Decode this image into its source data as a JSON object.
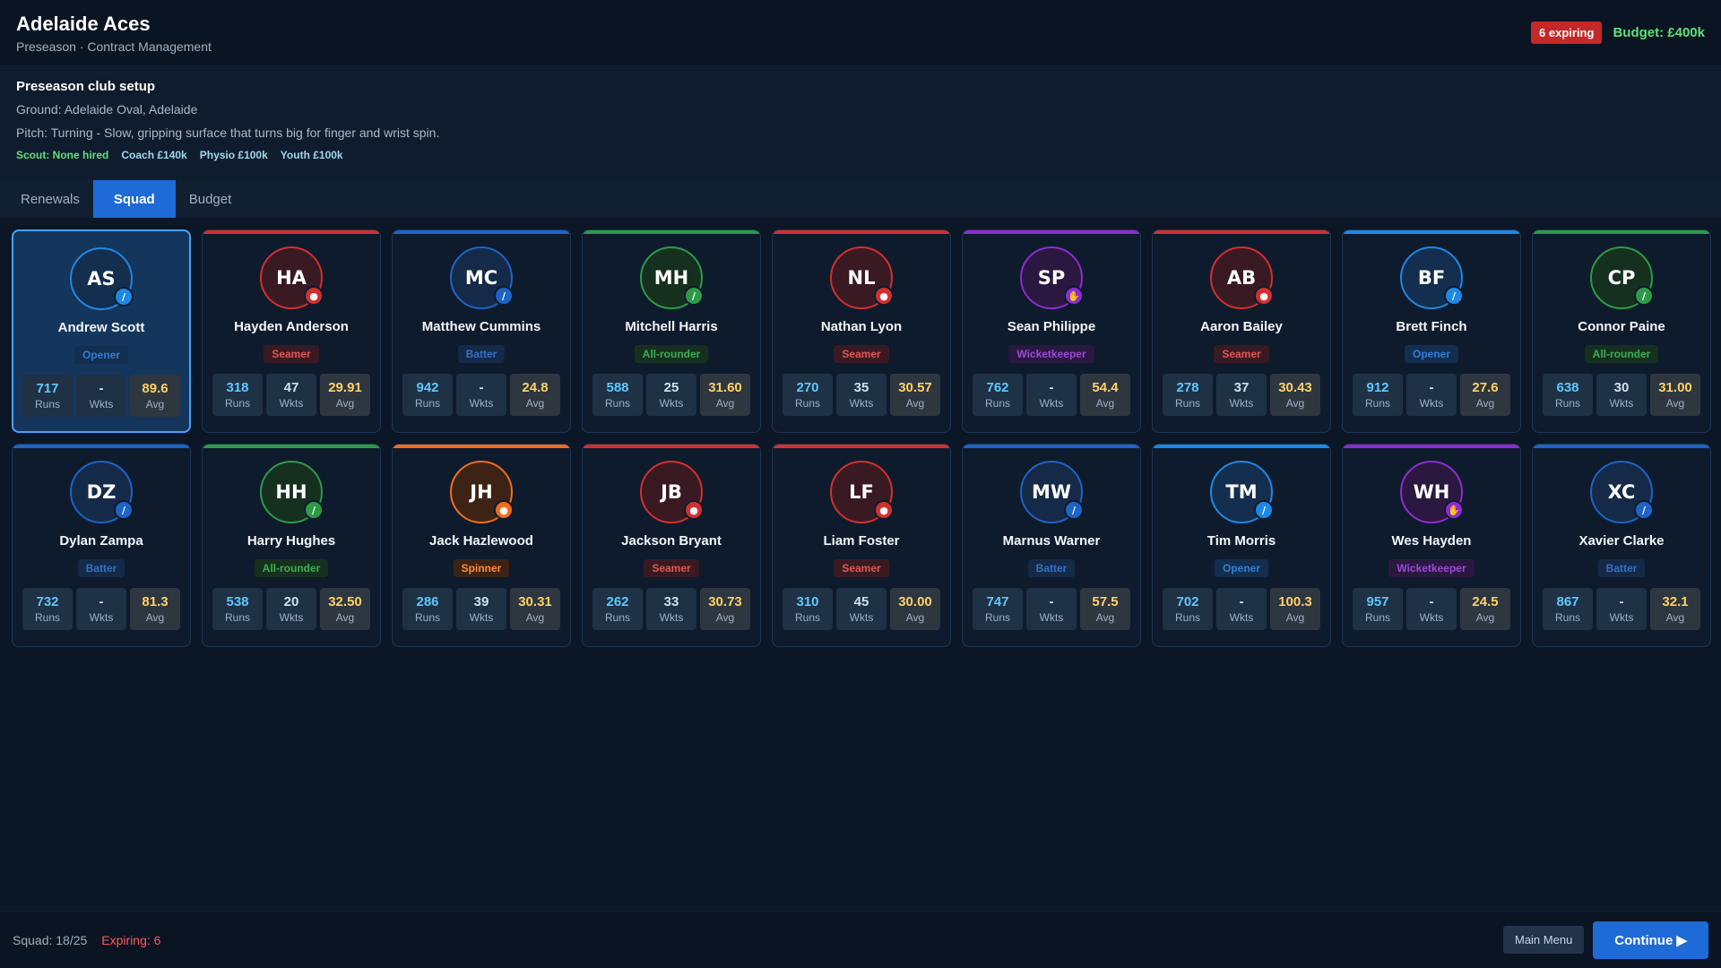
{
  "header": {
    "club_name": "Adelaide Aces",
    "subtitle": "Preseason · Contract Management",
    "expiring_badge": "6 expiring",
    "budget": "Budget: £400k"
  },
  "setup": {
    "title": "Preseason club setup",
    "ground": "Ground: Adelaide Oval, Adelaide",
    "pitch": "Pitch: Turning - Slow, gripping surface that turns big for finger and wrist spin.",
    "scout": "Scout: None hired",
    "coach": "Coach £140k",
    "physio": "Physio £100k",
    "youth": "Youth £100k"
  },
  "tabs": [
    {
      "label": "Renewals",
      "active": false
    },
    {
      "label": "Squad",
      "active": true
    },
    {
      "label": "Budget",
      "active": false
    }
  ],
  "stat_labels": {
    "runs": "Runs",
    "wkts": "Wkts",
    "avg": "Avg"
  },
  "role_styles": {
    "Opener": {
      "color": "#1e88e5",
      "tag_bg": "#132e4e",
      "tag_fg": "#2f7fd8",
      "icon": "bat-ball-icon"
    },
    "Batter": {
      "color": "#1e63c6",
      "tag_bg": "#142a48",
      "tag_fg": "#3570c4",
      "icon": "bat-icon"
    },
    "Seamer": {
      "color": "#d32f2f",
      "tag_bg": "#3a1a22",
      "tag_fg": "#e05555",
      "icon": "ball-icon"
    },
    "Spinner": {
      "color": "#f26b1d",
      "tag_bg": "#3d2316",
      "tag_fg": "#ff8a3d",
      "icon": "ball-icon"
    },
    "All-rounder": {
      "color": "#2e9a48",
      "tag_bg": "#16301f",
      "tag_fg": "#3cae55",
      "icon": "bat-ball-icon"
    },
    "Wicketkeeper": {
      "color": "#8e2bd0",
      "tag_bg": "#2a1840",
      "tag_fg": "#9b4ad6",
      "icon": "gloves-icon"
    }
  },
  "players": [
    {
      "initials": "AS",
      "name": "Andrew Scott",
      "role": "Opener",
      "runs": "717",
      "wkts": "-",
      "avg": "89.6",
      "selected": true
    },
    {
      "initials": "HA",
      "name": "Hayden Anderson",
      "role": "Seamer",
      "runs": "318",
      "wkts": "47",
      "avg": "29.91"
    },
    {
      "initials": "MC",
      "name": "Matthew Cummins",
      "role": "Batter",
      "runs": "942",
      "wkts": "-",
      "avg": "24.8"
    },
    {
      "initials": "MH",
      "name": "Mitchell Harris",
      "role": "All-rounder",
      "runs": "588",
      "wkts": "25",
      "avg": "31.60"
    },
    {
      "initials": "NL",
      "name": "Nathan Lyon",
      "role": "Seamer",
      "runs": "270",
      "wkts": "35",
      "avg": "30.57"
    },
    {
      "initials": "SP",
      "name": "Sean Philippe",
      "role": "Wicketkeeper",
      "runs": "762",
      "wkts": "-",
      "avg": "54.4"
    },
    {
      "initials": "AB",
      "name": "Aaron Bailey",
      "role": "Seamer",
      "runs": "278",
      "wkts": "37",
      "avg": "30.43"
    },
    {
      "initials": "BF",
      "name": "Brett Finch",
      "role": "Opener",
      "runs": "912",
      "wkts": "-",
      "avg": "27.6"
    },
    {
      "initials": "CP",
      "name": "Connor Paine",
      "role": "All-rounder",
      "runs": "638",
      "wkts": "30",
      "avg": "31.00"
    },
    {
      "initials": "DZ",
      "name": "Dylan Zampa",
      "role": "Batter",
      "runs": "732",
      "wkts": "-",
      "avg": "81.3"
    },
    {
      "initials": "HH",
      "name": "Harry Hughes",
      "role": "All-rounder",
      "runs": "538",
      "wkts": "20",
      "avg": "32.50"
    },
    {
      "initials": "JH",
      "name": "Jack Hazlewood",
      "role": "Spinner",
      "runs": "286",
      "wkts": "39",
      "avg": "30.31"
    },
    {
      "initials": "JB",
      "name": "Jackson Bryant",
      "role": "Seamer",
      "runs": "262",
      "wkts": "33",
      "avg": "30.73"
    },
    {
      "initials": "LF",
      "name": "Liam Foster",
      "role": "Seamer",
      "runs": "310",
      "wkts": "45",
      "avg": "30.00"
    },
    {
      "initials": "MW",
      "name": "Marnus Warner",
      "role": "Batter",
      "runs": "747",
      "wkts": "-",
      "avg": "57.5"
    },
    {
      "initials": "TM",
      "name": "Tim Morris",
      "role": "Opener",
      "runs": "702",
      "wkts": "-",
      "avg": "100.3"
    },
    {
      "initials": "WH",
      "name": "Wes Hayden",
      "role": "Wicketkeeper",
      "runs": "957",
      "wkts": "-",
      "avg": "24.5"
    },
    {
      "initials": "XC",
      "name": "Xavier Clarke",
      "role": "Batter",
      "runs": "867",
      "wkts": "-",
      "avg": "32.1"
    }
  ],
  "footer": {
    "squad": "Squad: 18/25",
    "expiring": "Expiring: 6",
    "main_menu": "Main Menu",
    "continue": "Continue ▶"
  }
}
